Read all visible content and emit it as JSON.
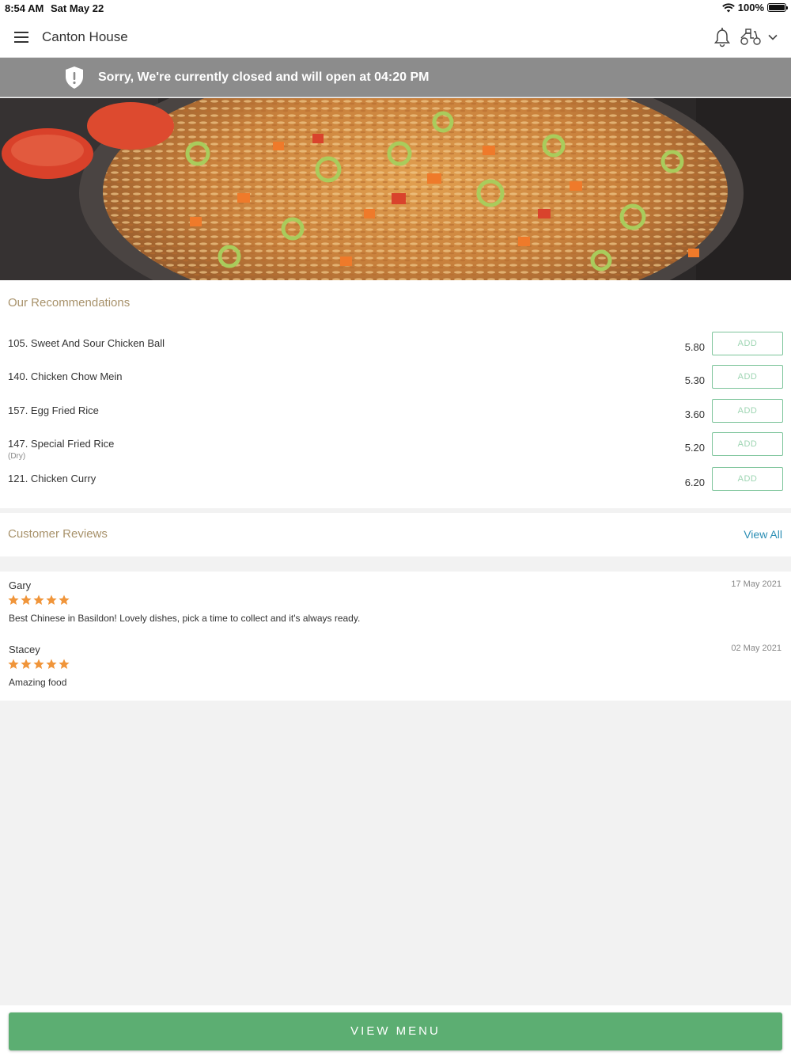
{
  "status_bar": {
    "time": "8:54 AM",
    "date": "Sat May 22",
    "battery": "100%"
  },
  "header": {
    "title": "Canton House",
    "icons": [
      "menu-icon",
      "bell-icon",
      "scooter-icon",
      "chevron-down-icon"
    ]
  },
  "banner": {
    "message": "Sorry, We're currently closed and will open at 04:20 PM",
    "icon": "shield-alert-icon"
  },
  "recommendations": {
    "title": "Our Recommendations",
    "items": [
      {
        "name": "105. Sweet And Sour Chicken Ball",
        "sub": "",
        "price": "5.80",
        "button": "ADD"
      },
      {
        "name": "140. Chicken Chow Mein",
        "sub": "",
        "price": "5.30",
        "button": "ADD"
      },
      {
        "name": "157. Egg Fried Rice",
        "sub": "",
        "price": "3.60",
        "button": "ADD"
      },
      {
        "name": "147. Special Fried Rice",
        "sub": "(Dry)",
        "price": "5.20",
        "button": "ADD"
      },
      {
        "name": "121. Chicken Curry",
        "sub": "",
        "price": "6.20",
        "button": "ADD"
      }
    ]
  },
  "reviews": {
    "title": "Customer Reviews",
    "view_all": "View All",
    "items": [
      {
        "name": "Gary",
        "date": "17 May 2021",
        "rating": 5,
        "text": "Best Chinese in Basildon! Lovely dishes, pick a time to collect and it's always ready."
      },
      {
        "name": "Stacey",
        "date": "02 May 2021",
        "rating": 5,
        "text": "Amazing food"
      }
    ]
  },
  "footer": {
    "button": "VIEW MENU"
  },
  "colors": {
    "accent_green": "#5cae72",
    "section_title": "#a8926b",
    "link": "#2d8fb5",
    "star": "#f0953a",
    "banner_bg": "#8c8c8c"
  }
}
